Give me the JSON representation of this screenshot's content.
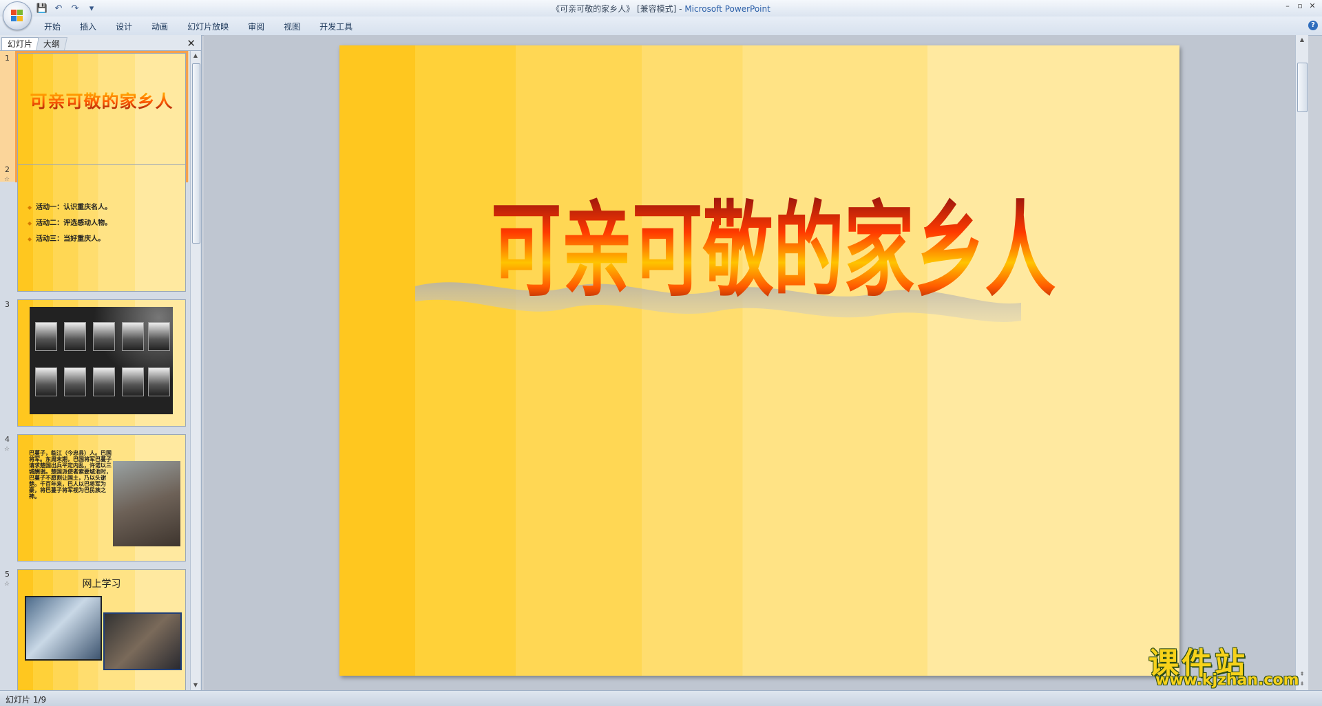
{
  "window": {
    "title_doc": "《可亲可敬的家乡人》 [兼容模式]",
    "title_sep": " - ",
    "title_app": "Microsoft PowerPoint",
    "controls": [
      "–",
      "▫",
      "✕"
    ]
  },
  "qat": {
    "save": "💾",
    "undo": "↶",
    "redo": "↷",
    "more": "▾"
  },
  "ribbon": {
    "tabs": [
      "开始",
      "插入",
      "设计",
      "动画",
      "幻灯片放映",
      "审阅",
      "视图",
      "开发工具"
    ],
    "help": "?"
  },
  "panel": {
    "tab_slides": "幻灯片",
    "tab_outline": "大纲",
    "close": "✕"
  },
  "thumbnails": [
    {
      "num": "1",
      "title": "可亲可敬的家乡人"
    },
    {
      "num": "2",
      "star": "☆",
      "items": [
        "活动一：认识重庆名人。",
        "活动二：评选感动人物。",
        "活动三：当好重庆人。"
      ]
    },
    {
      "num": "3"
    },
    {
      "num": "4",
      "star": "☆",
      "text": "巴蔓子，临江（今忠县）人。巴国将军。东周末期，巴国将军巴蔓子请求楚国出兵平定内乱，许诺以三城酬谢。楚国派使者索要城池时，巴蔓子不愿割让国土，乃以头谢楚。千百年来，巴人以巴将军为豪，将巴蔓子将军视为巴民族之神。"
    },
    {
      "num": "5",
      "star": "☆",
      "title": "网上学习"
    }
  ],
  "slide": {
    "title": "可亲可敬的家乡人"
  },
  "watermark": {
    "cn": "课件站",
    "url": "www.kjzhan.com"
  },
  "status": {
    "slide_info": "幻灯片 1/9"
  },
  "colors": {
    "accent": "#2b5fa8",
    "selection": "#f5a04c",
    "slide_base": "#ffc71f"
  }
}
